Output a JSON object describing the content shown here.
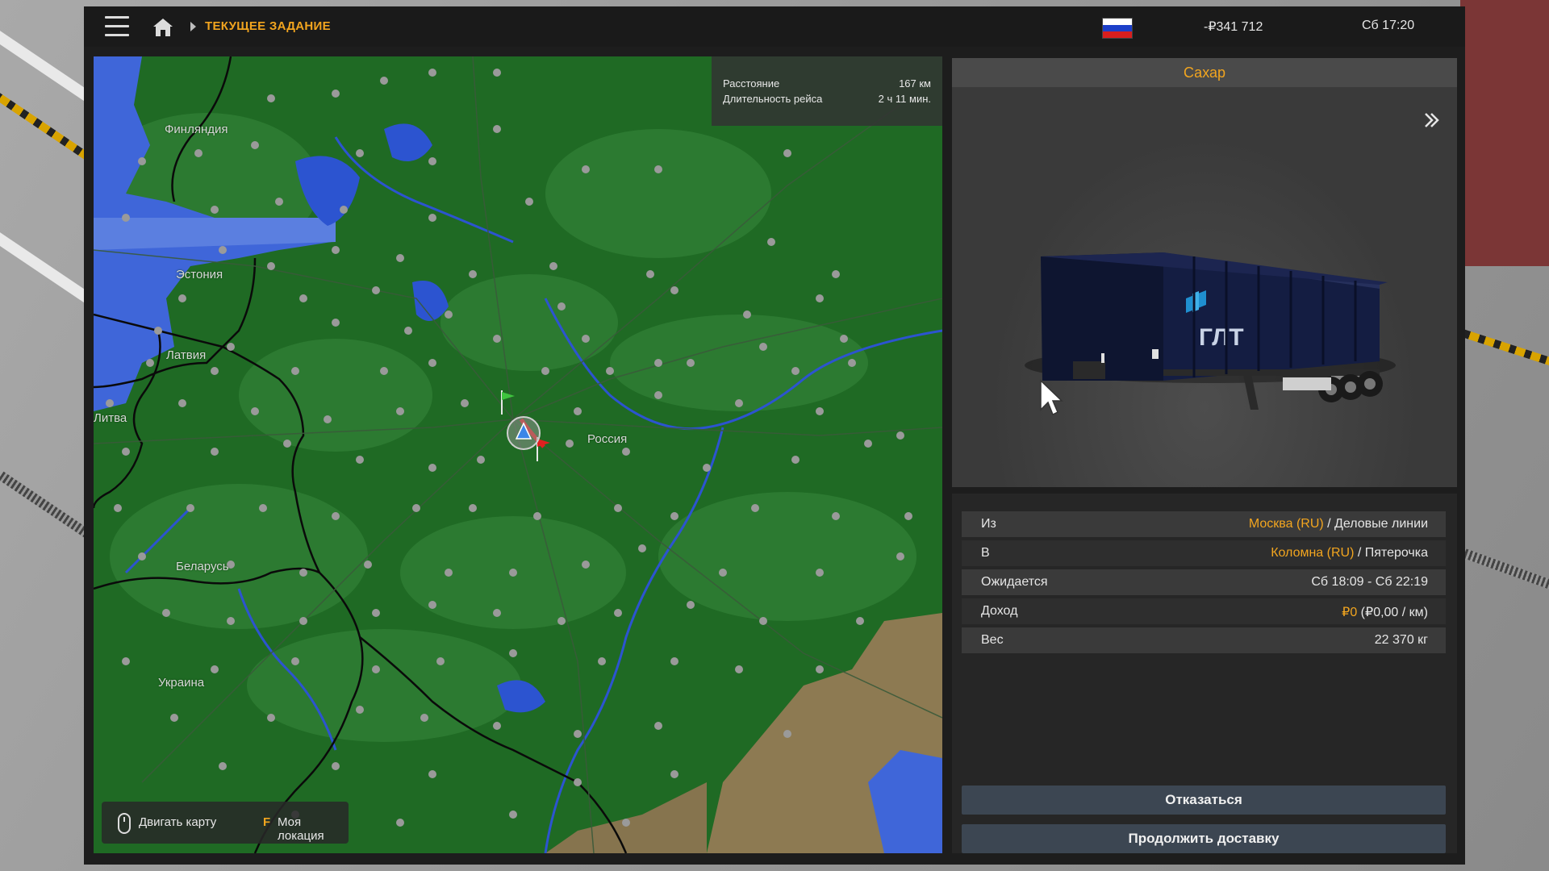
{
  "header": {
    "breadcrumb_title": "ТЕКУЩЕЕ ЗАДАНИЕ",
    "money": "-₽341 712",
    "clock": "Сб 17:20",
    "flag": "russia-flag-icon"
  },
  "map": {
    "labels": {
      "finland": "Финляндия",
      "estonia": "Эстония",
      "latvia": "Латвия",
      "lithuania": "Литва",
      "russia": "Россия",
      "belarus": "Беларусь",
      "ukraine": "Украина"
    },
    "route": {
      "distance_label": "Расстояние",
      "distance_value": "167 км",
      "duration_label": "Длительность рейса",
      "duration_value": "2 ч 11 мин."
    },
    "hints": {
      "move_map": "Двигать карту",
      "my_location_key": "F",
      "my_location": "Моя локация"
    }
  },
  "cargo": {
    "title": "Сахар",
    "trailer_brand": "ГЛТ"
  },
  "details": {
    "from_label": "Из",
    "from_city": "Москва (RU)",
    "from_company": " / Деловые линии",
    "to_label": "В",
    "to_city": "Коломна (RU)",
    "to_company": " / Пятерочка",
    "expected_label": "Ожидается",
    "expected_value": "Сб 18:09 - Сб 22:19",
    "income_label": "Доход",
    "income_value": "₽0",
    "income_rate": " (₽0,00 / км)",
    "weight_label": "Вес",
    "weight_value": "22 370 кг"
  },
  "buttons": {
    "decline": "Отказаться",
    "continue": "Продолжить доставку"
  },
  "colors": {
    "accent": "#f2a51f",
    "map_green": "#1f6a24",
    "water": "#3f66d9",
    "button": "#3c4652"
  }
}
